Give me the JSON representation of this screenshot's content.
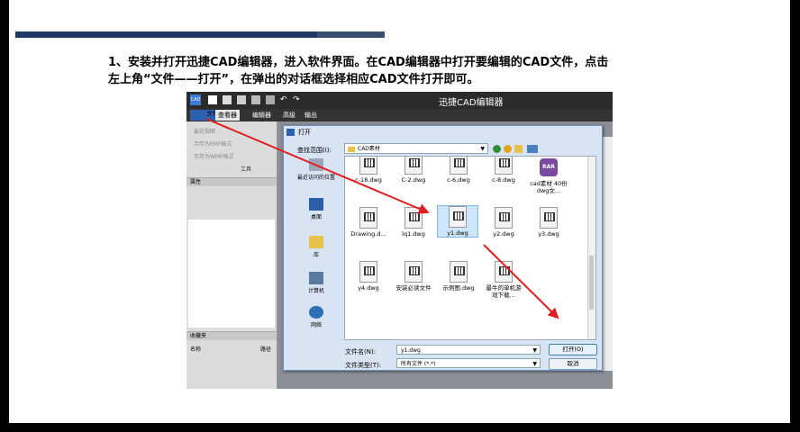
{
  "instruction": {
    "line1": "1、安装并打开迅捷CAD编辑器，进入软件界面。在CAD编辑器中打开要编辑的CAD文件，点击",
    "line2": "左上角“文件——打开”，在弹出的对话框选择相应CAD文件打开即可。"
  },
  "app": {
    "title": "迅捷CAD编辑器",
    "logo": "CAD",
    "tabs": [
      "文件",
      "查看器",
      "编辑器",
      "高级",
      "输出"
    ],
    "left_panel": {
      "rows": [
        "最近视图",
        "另存为EMF格式",
        "另存为WMF格式"
      ],
      "tools_label": "工具",
      "properties": "属性",
      "favorites": "收藏夹",
      "name_col": "名称",
      "path_col": "路径"
    }
  },
  "dialog": {
    "title": "打开",
    "look_in_label": "查找范围(I):",
    "look_in_value": "CAD素材",
    "places": [
      "最近访问的位置",
      "桌面",
      "库",
      "计算机",
      "网络"
    ],
    "files": [
      {
        "name": "c-18.dwg"
      },
      {
        "name": "C-2.dwg"
      },
      {
        "name": "c-6.dwg"
      },
      {
        "name": "c-8.dwg"
      },
      {
        "name": "cad素材 40份dwg文..."
      },
      {
        "name": "Drawing.d..."
      },
      {
        "name": "lq1.dwg"
      },
      {
        "name": "y1.dwg"
      },
      {
        "name": "y2.dwg"
      },
      {
        "name": "y3.dwg"
      },
      {
        "name": "y4.dwg"
      },
      {
        "name": "安装必读文件"
      },
      {
        "name": "示例图.dwg"
      },
      {
        "name": "最牛的单机游戏下载..."
      }
    ],
    "filename_label": "文件名(N):",
    "filename_value": "y1.dwg",
    "filetype_label": "文件类型(T):",
    "filetype_value": "所有文件 (*.*)",
    "open_button": "打开(O)",
    "cancel_button": "取消",
    "rar_badge": "RAR"
  },
  "colors": {
    "deco_dark": "#1f3864",
    "deco_light": "#3a4e70",
    "annotation_arrow": "#e02020"
  }
}
